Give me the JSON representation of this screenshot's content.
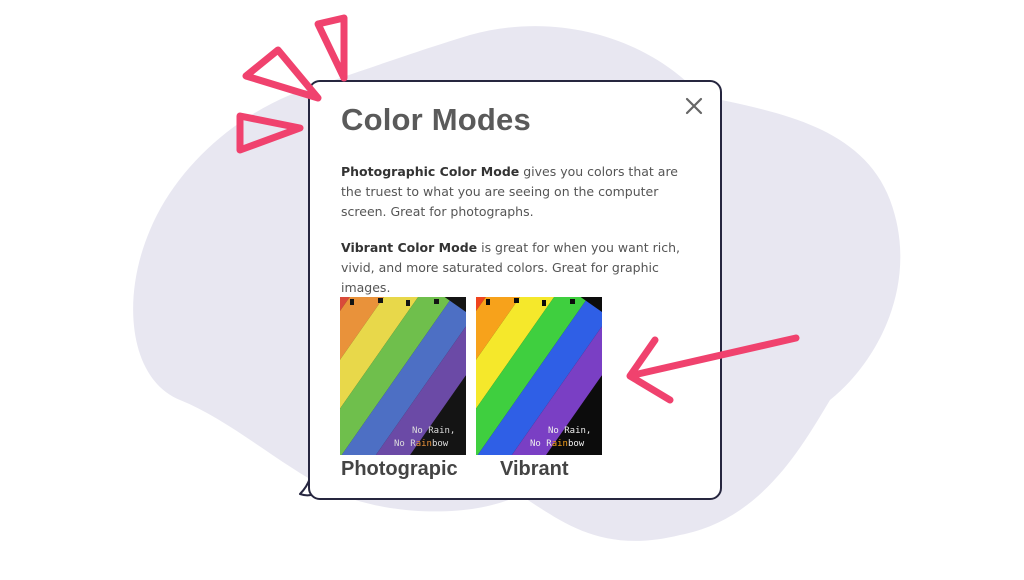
{
  "dialog": {
    "title": "Color Modes",
    "photographic_term": "Photographic Color Mode",
    "photographic_desc": " gives you colors that are the truest to what you are seeing on the computer screen. Great for photographs.",
    "vibrant_term": "Vibrant Color Mode",
    "vibrant_desc": " is great for when you want rich, vivid, and more saturated colors.  Great for graphic images.",
    "close_icon": "close-icon"
  },
  "samples": [
    {
      "caption": "Photograpic",
      "line1": "No Rain,",
      "line2_pre": "No R",
      "line2_hl": "ain",
      "line2_post": "bow"
    },
    {
      "caption": "Vibrant",
      "line1": "No Rain,",
      "line2_pre": "No R",
      "line2_hl": "ain",
      "line2_post": "bow"
    }
  ],
  "colors": {
    "accent": "#f0426e",
    "blob": "#e8e7f1",
    "border": "#26263f",
    "photographic_stripes": [
      "#d94a3a",
      "#e9923a",
      "#e8d84a",
      "#6fbf4c",
      "#4d6fc4",
      "#6b4aa6"
    ],
    "vibrant_stripes": [
      "#f0441e",
      "#f7a21b",
      "#f5e82b",
      "#3fcf3f",
      "#2f5fe6",
      "#7a3fc4"
    ]
  }
}
